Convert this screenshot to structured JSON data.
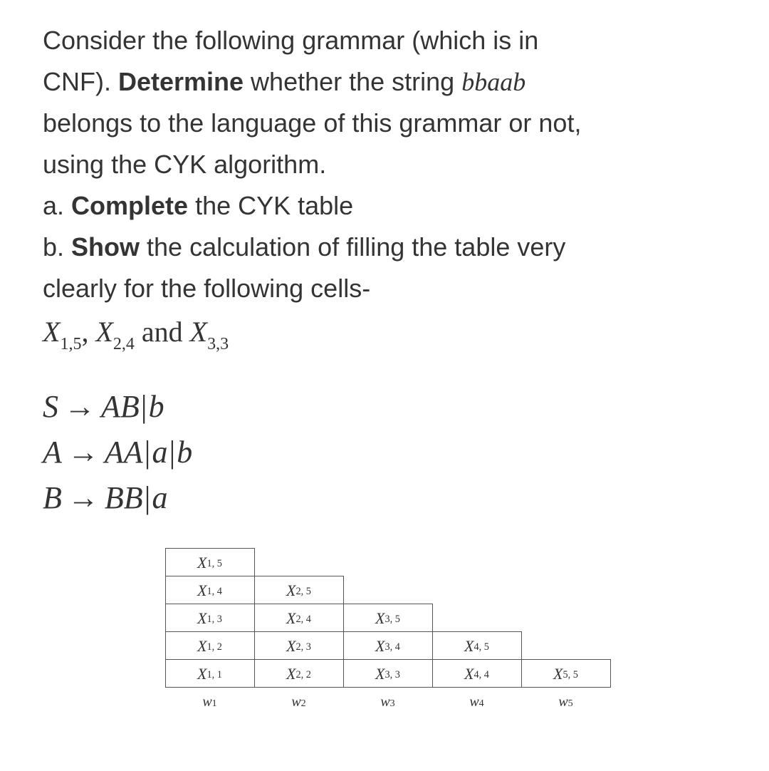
{
  "intro": {
    "l1a": "Consider the following grammar (which is in",
    "l2a": "CNF). ",
    "l2b": "Determine",
    "l2c": " whether the string ",
    "l2d": "bbaab",
    "l3": "belongs to the language of this grammar or not,",
    "l4": "using the CYK algorithm."
  },
  "parts": {
    "a_prefix": "a. ",
    "a_bold": "Complete",
    "a_rest": " the CYK table",
    "b_prefix": "b. ",
    "b_bold": "Show",
    "b_rest": " the calculation of filling the table very",
    "b_line2": "clearly for the following cells-"
  },
  "cells_line": {
    "x1": "X",
    "s1": "1,5",
    "comma": ", ",
    "x2": "X",
    "s2": "2,4",
    "and": " and ",
    "x3": "X",
    "s3": "3,3"
  },
  "grammar": {
    "r1_lhs": "S",
    "arrow": "→",
    "r1_rhs1": "AB",
    "pipe": "|",
    "r1_rhs2": "b",
    "r2_lhs": "A",
    "r2_rhs1": "AA",
    "r2_rhs2": "a",
    "r2_rhs3": "b",
    "r3_lhs": "B",
    "r3_rhs1": "BB",
    "r3_rhs2": "a"
  },
  "cyk": {
    "rows": [
      [
        {
          "x": "X",
          "sub": "1, 5"
        }
      ],
      [
        {
          "x": "X",
          "sub": "1, 4"
        },
        {
          "x": "X",
          "sub": "2, 5"
        }
      ],
      [
        {
          "x": "X",
          "sub": "1, 3"
        },
        {
          "x": "X",
          "sub": "2, 4"
        },
        {
          "x": "X",
          "sub": "3, 5"
        }
      ],
      [
        {
          "x": "X",
          "sub": "1, 2"
        },
        {
          "x": "X",
          "sub": "2, 3"
        },
        {
          "x": "X",
          "sub": "3, 4"
        },
        {
          "x": "X",
          "sub": "4, 5"
        }
      ],
      [
        {
          "x": "X",
          "sub": "1, 1"
        },
        {
          "x": "X",
          "sub": "2, 2"
        },
        {
          "x": "X",
          "sub": "3, 3"
        },
        {
          "x": "X",
          "sub": "4, 4"
        },
        {
          "x": "X",
          "sub": "5, 5"
        }
      ]
    ],
    "w": [
      {
        "w": "w",
        "sub": "1"
      },
      {
        "w": "w",
        "sub": "2"
      },
      {
        "w": "w",
        "sub": "3"
      },
      {
        "w": "w",
        "sub": "4"
      },
      {
        "w": "w",
        "sub": "5"
      }
    ]
  }
}
